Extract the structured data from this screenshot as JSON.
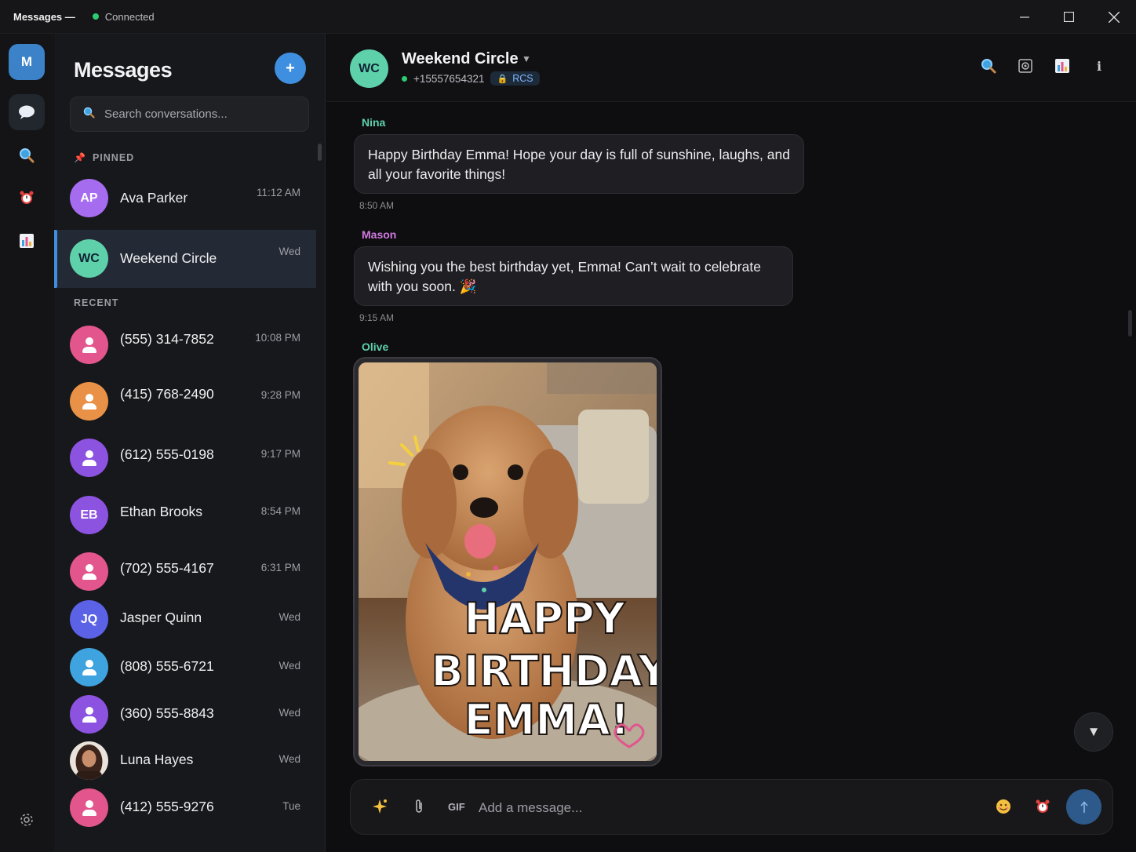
{
  "window": {
    "title": "Messages —",
    "connection_status": "Connected"
  },
  "rail": {
    "me_initial": "M",
    "items": [
      "chat-icon",
      "search-icon",
      "alarm-icon",
      "stats-icon",
      "settings-icon"
    ]
  },
  "sidebar": {
    "title": "Messages",
    "new_button": "+",
    "search_placeholder": "Search conversations...",
    "pinned_label": "PINNED",
    "recent_label": "RECENT",
    "pinned": [
      {
        "initials": "AP",
        "name": "Ava Parker",
        "time": "11:12 AM",
        "color": "#a56cf0"
      },
      {
        "initials": "WC",
        "name": "Weekend Circle",
        "time": "Wed",
        "color": "#5ed1ab"
      }
    ],
    "recent": [
      {
        "initials": "",
        "name": "(555) 314-7852",
        "time": "10:08 PM",
        "color": "#e2558d"
      },
      {
        "initials": "",
        "name": "(415) 768-2490",
        "time": "9:28 PM",
        "color": "#e89147"
      },
      {
        "initials": "",
        "name": "(612) 555-0198",
        "time": "9:17 PM",
        "color": "#8c52e0"
      },
      {
        "initials": "EB",
        "name": "Ethan Brooks",
        "time": "8:54 PM",
        "color": "#8c52e0"
      },
      {
        "initials": "",
        "name": "(702) 555-4167",
        "time": "6:31 PM",
        "color": "#e2558d"
      },
      {
        "initials": "JQ",
        "name": "Jasper Quinn",
        "time": "Wed",
        "color": "#5b62e6"
      },
      {
        "initials": "",
        "name": "(808) 555-6721",
        "time": "Wed",
        "color": "#3fa3e0"
      },
      {
        "initials": "",
        "name": "(360) 555-8843",
        "time": "Wed",
        "color": "#8c52e0"
      },
      {
        "initials": "",
        "name": "Luna Hayes",
        "time": "Wed",
        "color": "#5a3a2e"
      },
      {
        "initials": "",
        "name": "(412) 555-9276",
        "time": "Tue",
        "color": "#e2558d"
      }
    ]
  },
  "chat": {
    "initials": "WC",
    "name": "Weekend Circle",
    "phone": "+15557654321",
    "badge": "RCS",
    "messages": [
      {
        "sender": "Nina",
        "sender_color": "#5ed1ab",
        "text": "Happy Birthday Emma! Hope your day is full of sunshine, laughs, and all your favorite things!",
        "time": "8:50 AM"
      },
      {
        "sender": "Mason",
        "sender_color": "#d07ae0",
        "text": "Wishing you the best birthday yet, Emma! Can’t wait to celebrate with you soon. 🎉",
        "time": "9:15 AM"
      },
      {
        "sender": "Olive",
        "sender_color": "#5ed1ab"
      }
    ],
    "image_text": [
      "HAPPY",
      "BIRTHDAY",
      "EMMA!"
    ],
    "composer_placeholder": "Add a message...",
    "gif_label": "GIF"
  }
}
